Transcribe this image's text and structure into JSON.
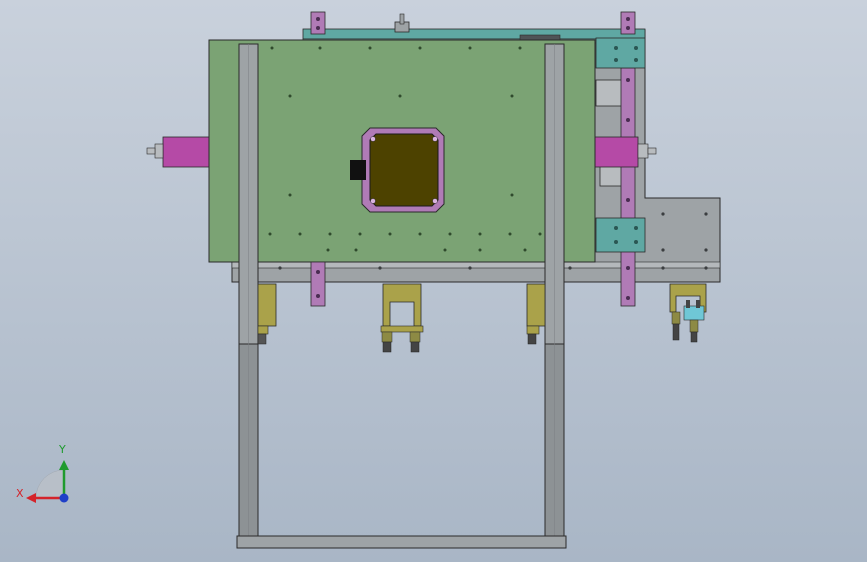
{
  "viewport": {
    "background_top": "#c9d1dc",
    "background_bottom": "#a9b6c6"
  },
  "triad": {
    "x_label": "X",
    "y_label": "Y",
    "x_color": "#d4232a",
    "y_color": "#1f9b2e",
    "z_color": "#1f3fc8"
  },
  "colors": {
    "plate_green": "#7ba374",
    "frame_gray": "#9ea3a6",
    "rail_teal": "#5fa8a3",
    "bracket_purple": "#b07bb6",
    "motor_magenta": "#b54aa6",
    "motor_body": "#4d4200",
    "sensor_olive": "#aaa24a",
    "sensor_cyan": "#6fc7d6",
    "outline": "#2a2a2a"
  }
}
